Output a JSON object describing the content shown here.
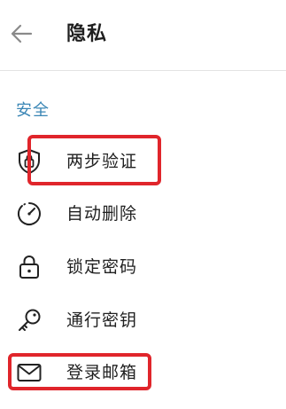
{
  "header": {
    "back_icon": "arrow-left-icon",
    "title": "隐私"
  },
  "section": {
    "title": "安全",
    "accent_color": "#3a86b5"
  },
  "items": [
    {
      "label": "两步验证",
      "icon": "shield-lock-icon",
      "highlighted": true
    },
    {
      "label": "自动删除",
      "icon": "timer-icon",
      "highlighted": false
    },
    {
      "label": "锁定密码",
      "icon": "padlock-icon",
      "highlighted": false
    },
    {
      "label": "通行密钥",
      "icon": "key-icon",
      "highlighted": false
    },
    {
      "label": "登录邮箱",
      "icon": "mail-icon",
      "highlighted": true
    }
  ],
  "highlight_color": "#e0252b"
}
